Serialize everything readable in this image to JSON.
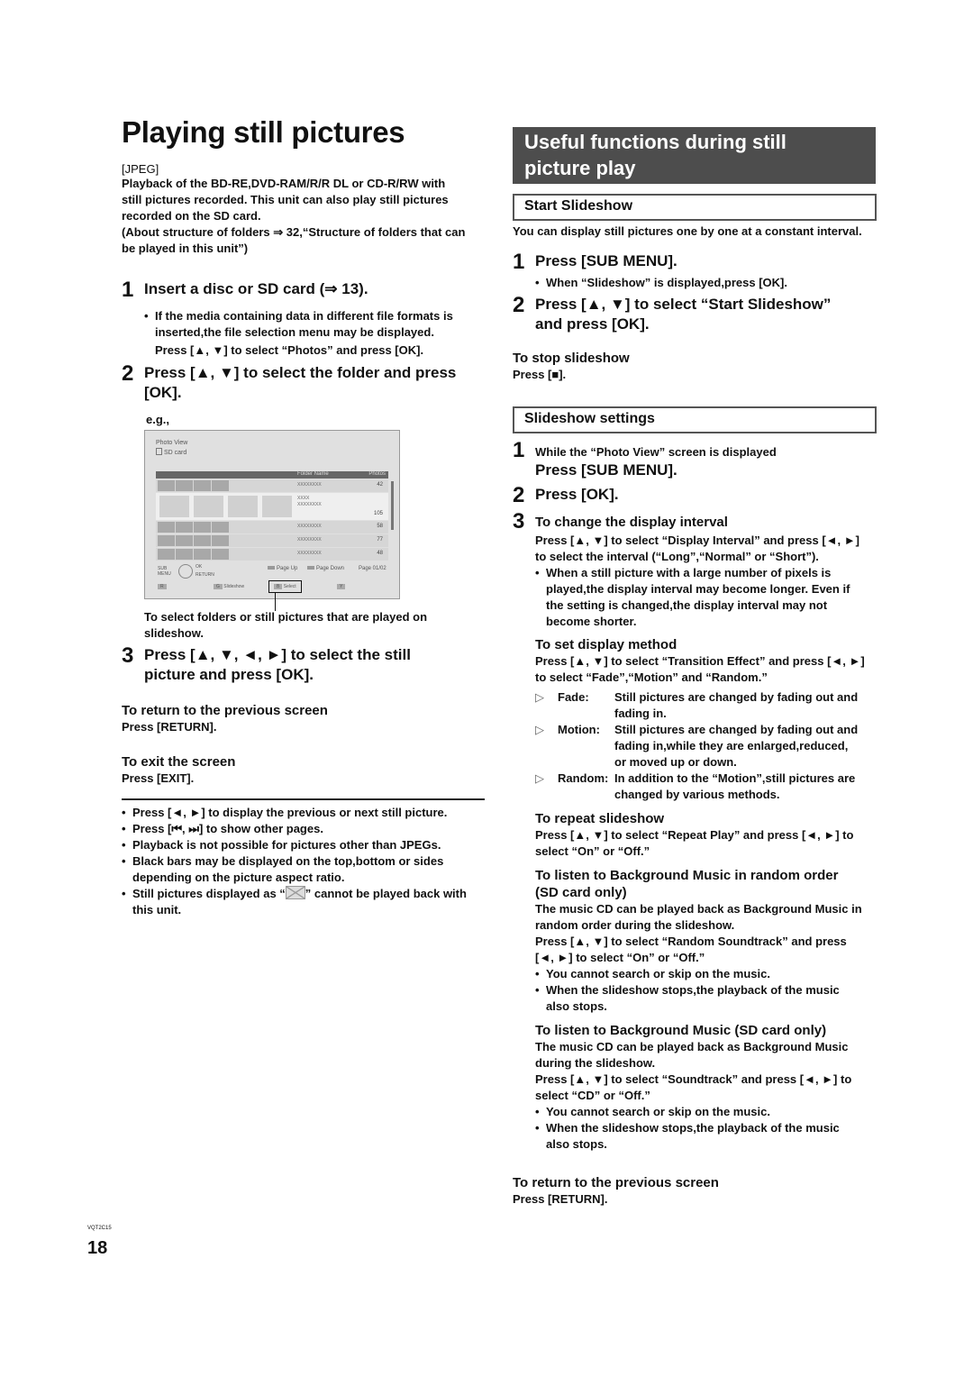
{
  "page": {
    "title": "Playing still pictures",
    "page_number": "18",
    "model_code": "VQT2C15"
  },
  "left": {
    "media_tag": "[JPEG]",
    "intro": [
      "Playback of the BD-RE,DVD-RAM/R/R DL or CD-R/RW with",
      "still pictures recorded. This unit can also play still pictures",
      "recorded on the SD card.",
      "(About structure of folders ⇒ 32,“Structure of folders that can",
      "be played in this unit”)"
    ],
    "step1": {
      "num": "1",
      "text": "Insert a disc or SD card (⇒ 13).",
      "bullet": [
        "If the media containing data in different file formats is",
        "inserted,the file selection menu may be displayed."
      ],
      "press": "Press [▲, ▼] to select “Photos” and press [OK]."
    },
    "step2": {
      "num": "2",
      "text1": "Press [▲, ▼] to select the folder and press",
      "text2": "[OK].",
      "eg": "e.g.,"
    },
    "screen": {
      "title": "Photo View",
      "source": "SD card",
      "col_folder": "Folder Name",
      "col_photos": "Photos",
      "rows": [
        {
          "name": "XXXXXXXX",
          "count": "42"
        },
        {
          "name": "XXXX\nXXXXXXXX",
          "count": "105"
        },
        {
          "name": "XXXXXXXX",
          "count": "58"
        },
        {
          "name": "XXXXXXXX",
          "count": "77"
        },
        {
          "name": "XXXXXXXX",
          "count": "48"
        }
      ],
      "sub_menu": "SUB MENU",
      "ok": "OK",
      "return": "RETURN",
      "page_up": "Page Up",
      "page_down": "Page Down",
      "page": "Page 01/02",
      "buttons": {
        "r": "R",
        "g": "G",
        "g_label": "Slideshow",
        "b": "B",
        "b_label": "Select",
        "y": "Y"
      }
    },
    "caption": [
      "To select folders or still pictures that are played on",
      "slideshow."
    ],
    "step3": {
      "num": "3",
      "text1": "Press [▲, ▼, ◄, ►] to select the still",
      "text2": "picture and press [OK]."
    },
    "return_head": "To return to the previous screen",
    "return_press": "Press [RETURN].",
    "exit_head": "To exit the screen",
    "exit_press": "Press [EXIT].",
    "notes": [
      "Press [◄, ►] to display the previous or next still picture.",
      "Press [⏮, ⏭] to show other pages.",
      "Playback is not possible for pictures other than JPEGs.",
      "Black bars may be displayed on the top,bottom or sides",
      "depending on the picture aspect ratio.",
      "Still pictures displayed as “",
      "” cannot be played back with",
      "this unit."
    ]
  },
  "right": {
    "banner": [
      "Useful functions during still",
      "picture play"
    ],
    "start": {
      "head": "Start Slideshow",
      "intro": "You can display still pictures one by one at a constant interval.",
      "step1": "Press [SUB MENU].",
      "step1_bullet": "When “Slideshow” is displayed,press [OK].",
      "step2a": "Press [▲, ▼] to select “Start Slideshow”",
      "step2b": "and press [OK].",
      "stop_head": "To stop slideshow",
      "stop_press": "Press [■]."
    },
    "settings": {
      "head": "Slideshow settings",
      "step1_small": "While the “Photo View” screen is displayed",
      "step1": "Press [SUB MENU].",
      "step2": "Press [OK].",
      "step3": "To change the display interval",
      "interval": [
        "Press [▲, ▼] to select “Display Interval” and press [◄, ►]",
        "to select the interval (“Long”,“Normal” or “Short”)."
      ],
      "interval_bullet": [
        "When a still picture with a large number of pixels is",
        "played,the display interval may become longer. Even if",
        "the setting is changed,the display interval may not",
        "become shorter."
      ],
      "method_head": "To set display method",
      "method": [
        "Press [▲, ▼] to select “Transition Effect” and press [◄, ►]",
        "to select “Fade”,“Motion” and “Random.”"
      ],
      "methods": [
        {
          "label": "Fade:",
          "lines": [
            "Still pictures are changed by fading out and",
            "fading in."
          ]
        },
        {
          "label": "Motion:",
          "lines": [
            "Still pictures are changed by fading out and",
            "fading in,while they are enlarged,reduced,",
            "or moved up or down."
          ]
        },
        {
          "label": "Random:",
          "lines": [
            "In addition to the “Motion”,still pictures are",
            "changed by various methods."
          ]
        }
      ],
      "repeat_head": "To repeat slideshow",
      "repeat": [
        "Press [▲, ▼] to select “Repeat Play” and press [◄, ►] to",
        "select “On” or “Off.”"
      ],
      "bgm_random_head": [
        "To listen to Background Music in random order",
        "(SD card only)"
      ],
      "bgm_random": [
        "The music CD can be played back as Background Music in",
        "random order during the slideshow.",
        "Press [▲, ▼] to select “Random Soundtrack” and press",
        "[◄, ►] to select “On” or “Off.”"
      ],
      "bgm_random_bullets": [
        "You cannot search or skip on the music.",
        "When the slideshow stops,the playback of the music",
        "also stops."
      ],
      "bgm_head": "To listen to Background Music (SD card only)",
      "bgm": [
        "The music CD can be played back as Background Music",
        "during the slideshow.",
        "Press [▲, ▼] to select “Soundtrack” and press [◄, ►] to",
        "select “CD” or “Off.”"
      ],
      "bgm_bullets": [
        "You cannot search or skip on the music.",
        "When the slideshow stops,the playback of the music",
        "also stops."
      ],
      "return_head": "To return to the previous screen",
      "return_press": "Press [RETURN]."
    }
  }
}
